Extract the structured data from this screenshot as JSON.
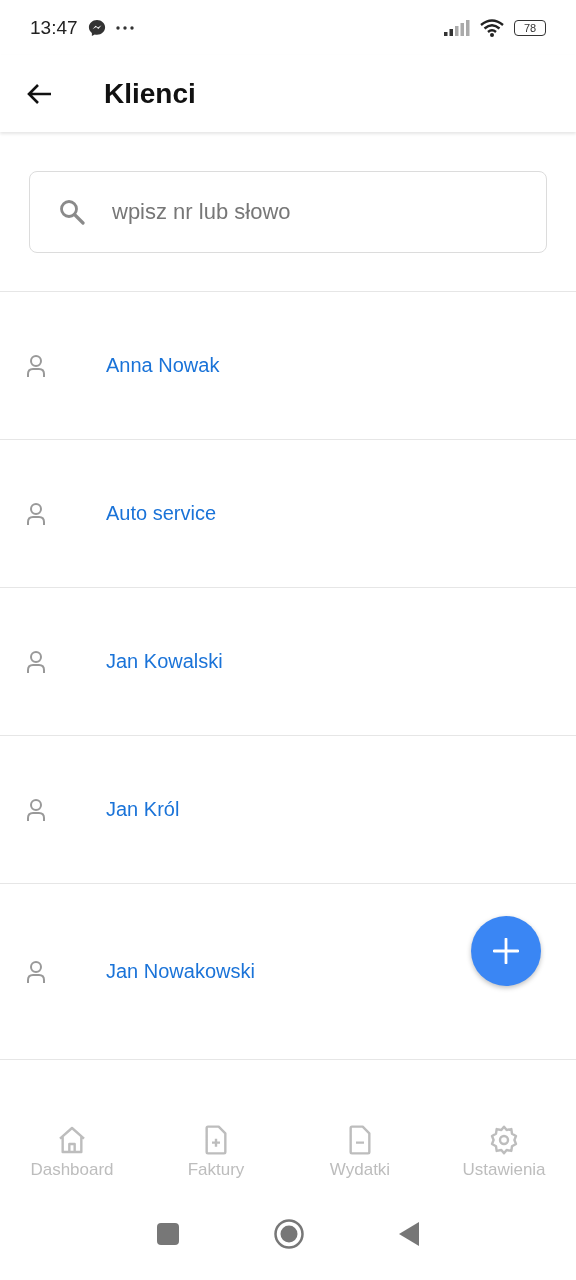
{
  "status_bar": {
    "time": "13:47",
    "battery": "78"
  },
  "header": {
    "title": "Klienci"
  },
  "search": {
    "placeholder": "wpisz nr lub słowo"
  },
  "clients": [
    {
      "name": "Anna Nowak"
    },
    {
      "name": "Auto service"
    },
    {
      "name": "Jan Kowalski"
    },
    {
      "name": "Jan Król"
    },
    {
      "name": "Jan Nowakowski"
    }
  ],
  "bottom_nav": [
    {
      "label": "Dashboard",
      "kind": "home",
      "selected": false
    },
    {
      "label": "Faktury",
      "kind": "add",
      "selected": false
    },
    {
      "label": "Wydatki",
      "kind": "remove",
      "selected": false
    },
    {
      "label": "Ustawienia",
      "kind": "settings",
      "selected": false
    }
  ]
}
